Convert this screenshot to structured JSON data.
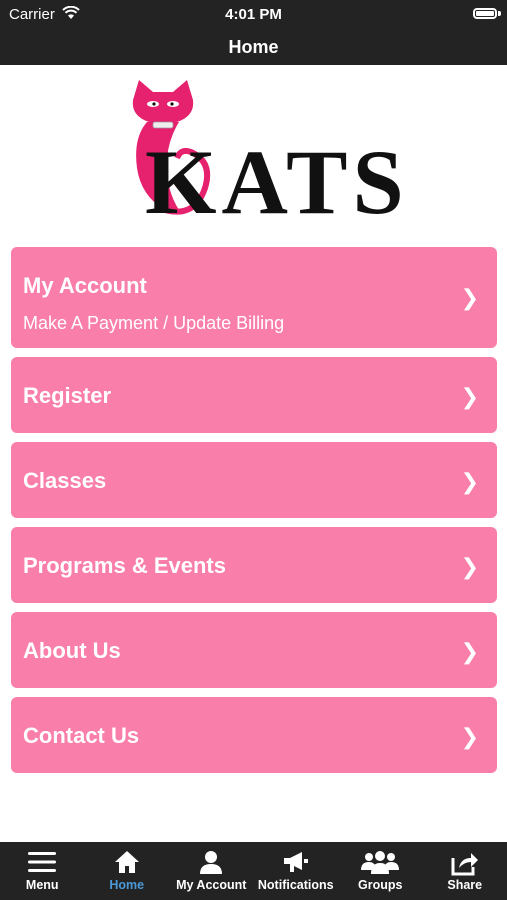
{
  "status": {
    "carrier": "Carrier",
    "time": "4:01 PM"
  },
  "header": {
    "title": "Home"
  },
  "logo": {
    "text": "KATS",
    "brand_color": "#e6226f"
  },
  "menu": {
    "items": [
      {
        "title": "My Account",
        "subtitle": "Make A Payment / Update Billing"
      },
      {
        "title": "Register"
      },
      {
        "title": "Classes"
      },
      {
        "title": "Programs & Events"
      },
      {
        "title": "About Us"
      },
      {
        "title": "Contact Us"
      }
    ],
    "chevron": "❯",
    "item_color": "#f97ea9"
  },
  "tabbar": {
    "active_color": "#4a9ad8",
    "tabs": [
      {
        "label": "Menu",
        "icon": "hamburger-icon"
      },
      {
        "label": "Home",
        "icon": "house-icon",
        "active": true
      },
      {
        "label": "My Account",
        "icon": "person-icon"
      },
      {
        "label": "Notifications",
        "icon": "megaphone-icon"
      },
      {
        "label": "Groups",
        "icon": "group-icon"
      },
      {
        "label": "Share",
        "icon": "share-icon"
      }
    ]
  }
}
